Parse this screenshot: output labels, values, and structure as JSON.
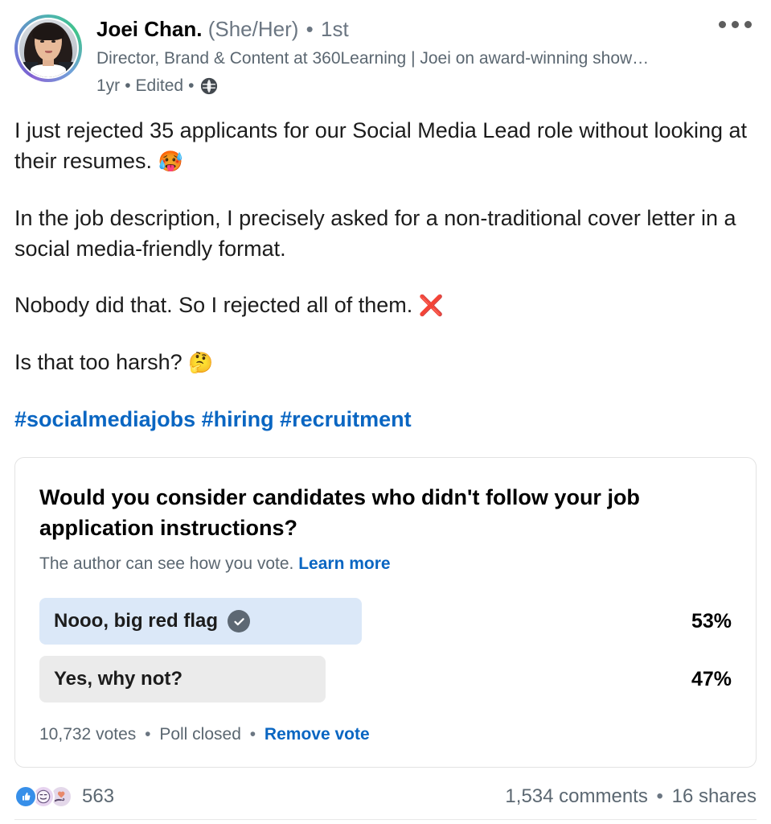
{
  "post": {
    "author": {
      "name": "Joei Chan.",
      "pronouns": "(She/Her)",
      "connection_degree": "1st",
      "headline": "Director, Brand & Content at 360Learning | Joei on award-winning show…",
      "avatar_alt": "profile-photo"
    },
    "meta": {
      "age": "1yr",
      "edited": "Edited",
      "visibility_icon": "globe-icon",
      "separator": "•"
    },
    "more_menu": "more-options",
    "content": {
      "paragraphs": [
        {
          "text": "I just rejected 35 applicants for our Social Media Lead role without looking at their resumes. ",
          "emoji": "🥵"
        },
        {
          "text": "In the job description, I precisely asked for a non-traditional cover letter in a social media-friendly format.",
          "emoji": ""
        },
        {
          "text": "Nobody did that. So I rejected all of them. ",
          "emoji": "❌"
        },
        {
          "text": "Is that too harsh? ",
          "emoji": "🤔"
        }
      ],
      "hashtags": "#socialmediajobs #hiring #recruitment"
    }
  },
  "poll": {
    "question": "Would you consider candidates who didn't follow your job application instructions?",
    "subtitle": "The author can see how you vote.",
    "learn_more_label": "Learn more",
    "options": [
      {
        "label": "Nooo, big red flag",
        "percent": "53%",
        "percent_value": 53,
        "selected": true,
        "bar_color": "#dbe8f8",
        "check_icon": "check-circle-icon"
      },
      {
        "label": "Yes, why not?",
        "percent": "47%",
        "percent_value": 47,
        "selected": false,
        "bar_color": "#ebebeb",
        "check_icon": ""
      }
    ],
    "footer": {
      "votes": "10,732 votes",
      "status": "Poll closed",
      "action_label": "Remove vote",
      "separator": "•"
    }
  },
  "social": {
    "reactions": [
      {
        "name": "like-reaction-icon",
        "color": "#378fe9"
      },
      {
        "name": "funny-reaction-icon",
        "color": "#e7d4f0"
      },
      {
        "name": "support-reaction-icon",
        "color": "#e4d8ea"
      }
    ],
    "reaction_count": "563",
    "comments": "1,534 comments",
    "shares": "16 shares",
    "separator": "•"
  },
  "chart_data": {
    "type": "bar",
    "title": "Would you consider candidates who didn't follow your job application instructions?",
    "categories": [
      "Nooo, big red flag",
      "Yes, why not?"
    ],
    "values": [
      53,
      47
    ],
    "unit": "%",
    "total_votes": 10732,
    "ylabel": "",
    "xlabel": "",
    "ylim": [
      0,
      100
    ],
    "grid": false,
    "legend": false
  },
  "colors": {
    "link": "#0a66c2",
    "text_primary": "#1c1c1c",
    "text_secondary": "#5b6771",
    "selected_bar": "#dbe8f8",
    "plain_bar": "#ebebeb",
    "card_border": "#e3e3e3"
  }
}
